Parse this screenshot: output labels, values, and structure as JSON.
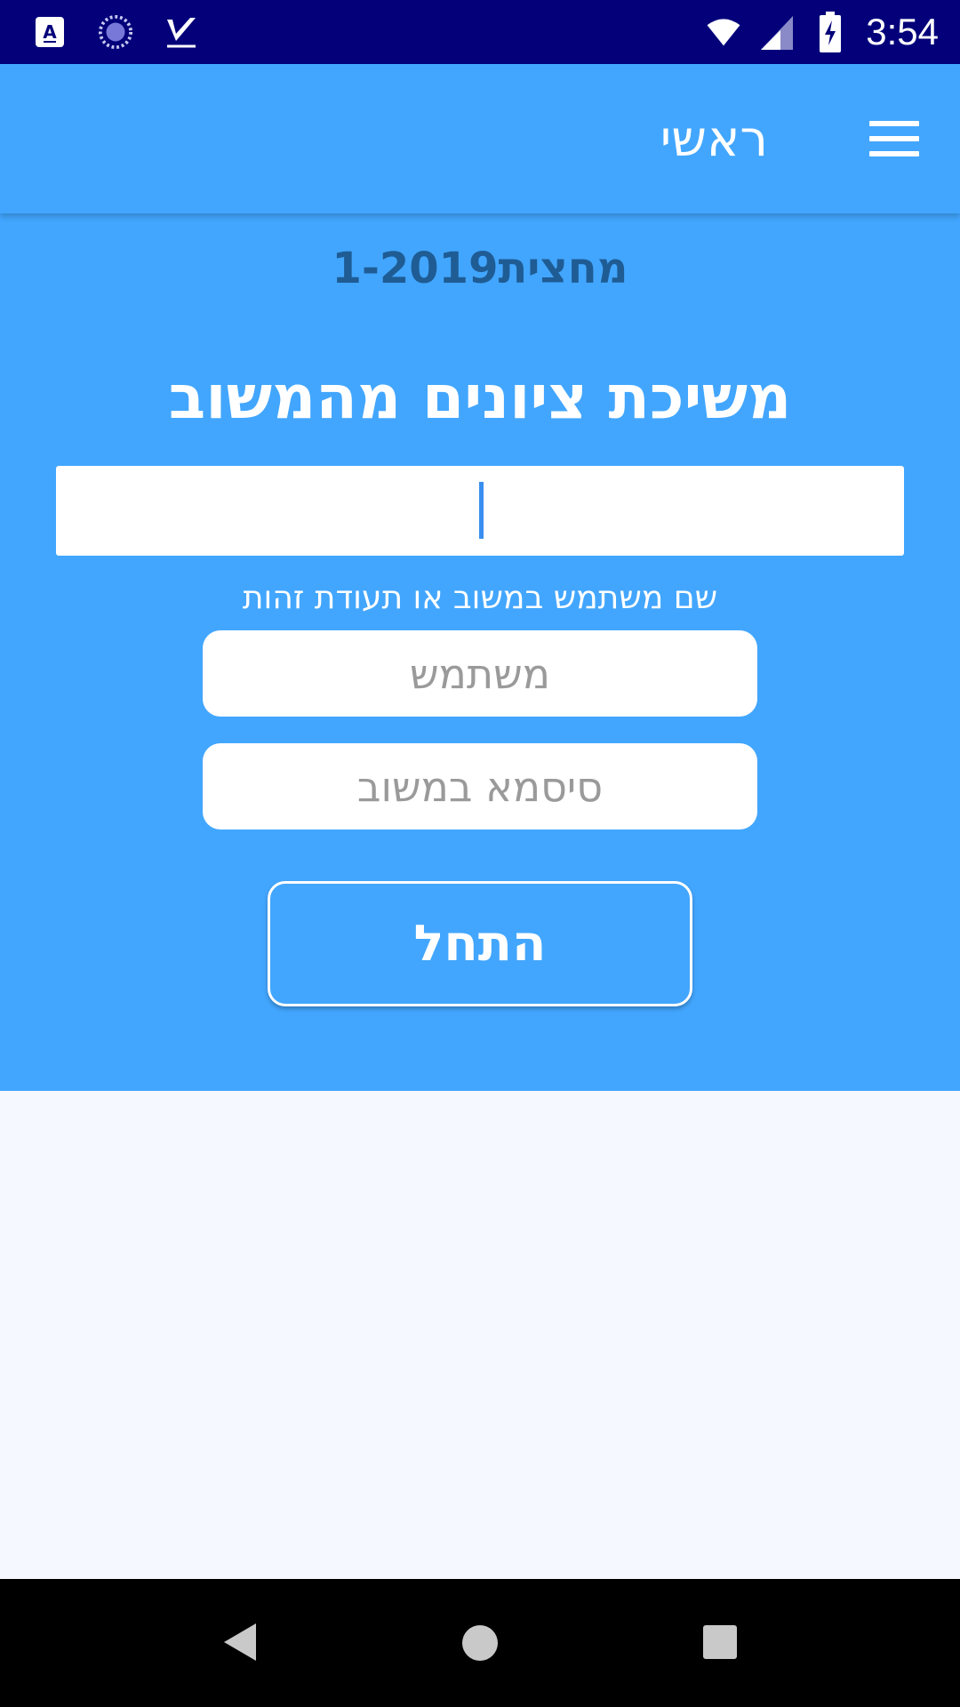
{
  "status_bar": {
    "time": "3:54",
    "icons": [
      "accessibility-a-icon",
      "sync-icon",
      "check-app-icon",
      "wifi-icon",
      "signal-icon",
      "battery-charging-icon"
    ]
  },
  "app_bar": {
    "title": "ראשי",
    "menu_icon": "hamburger-menu-icon"
  },
  "main": {
    "semester": "מחצית1-2019",
    "heading": "משיכת ציונים מהמשוב",
    "captcha_input_value": "",
    "hint": "שם משתמש במשוב או תעודת זהות",
    "username_placeholder": "משתמש",
    "password_placeholder": "סיסמא במשוב",
    "start_label": "התחל"
  },
  "colors": {
    "status_bar": "#03007a",
    "primary": "#42a6fe",
    "semester_text": "#1f5c94",
    "background": "#f5f8fe"
  },
  "nav_bar": {
    "icons": [
      "back-icon",
      "home-icon",
      "recent-apps-icon"
    ]
  }
}
